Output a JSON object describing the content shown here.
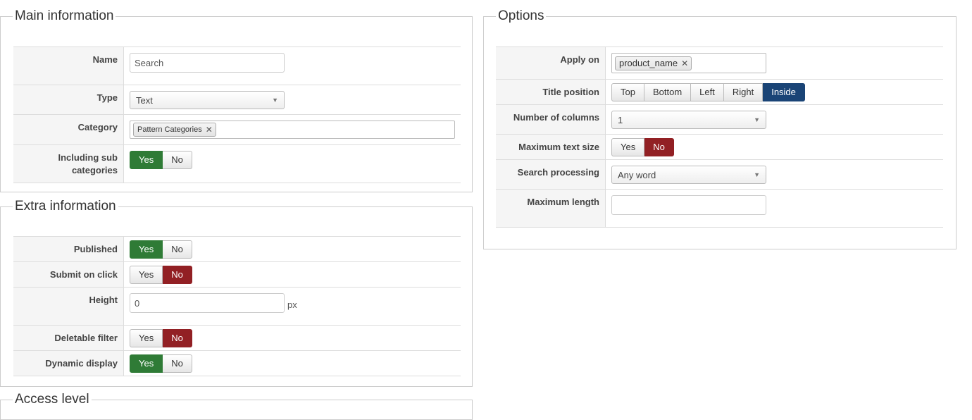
{
  "main_info": {
    "legend": "Main information",
    "name_label": "Name",
    "name_value": "Search",
    "type_label": "Type",
    "type_value": "Text",
    "category_label": "Category",
    "category_tag": "Pattern Categories",
    "including_label": "Including sub categories",
    "including_yes": "Yes",
    "including_no": "No"
  },
  "extra_info": {
    "legend": "Extra information",
    "published_label": "Published",
    "published_yes": "Yes",
    "published_no": "No",
    "submit_label": "Submit on click",
    "submit_yes": "Yes",
    "submit_no": "No",
    "height_label": "Height",
    "height_value": "0",
    "height_unit": "px",
    "deletable_label": "Deletable filter",
    "deletable_yes": "Yes",
    "deletable_no": "No",
    "dynamic_label": "Dynamic display",
    "dynamic_yes": "Yes",
    "dynamic_no": "No"
  },
  "access": {
    "legend": "Access level"
  },
  "options": {
    "legend": "Options",
    "apply_label": "Apply on",
    "apply_tag": "product_name",
    "title_pos_label": "Title position",
    "title_pos_options": [
      "Top",
      "Bottom",
      "Left",
      "Right",
      "Inside"
    ],
    "title_pos_selected": "Inside",
    "columns_label": "Number of columns",
    "columns_value": "1",
    "max_text_label": "Maximum text size",
    "max_text_yes": "Yes",
    "max_text_no": "No",
    "search_proc_label": "Search processing",
    "search_proc_value": "Any word",
    "max_length_label": "Maximum length",
    "max_length_value": ""
  },
  "colors": {
    "yes_active": "#2f7b36",
    "no_active": "#922024",
    "selected_position": "#1a4476"
  }
}
